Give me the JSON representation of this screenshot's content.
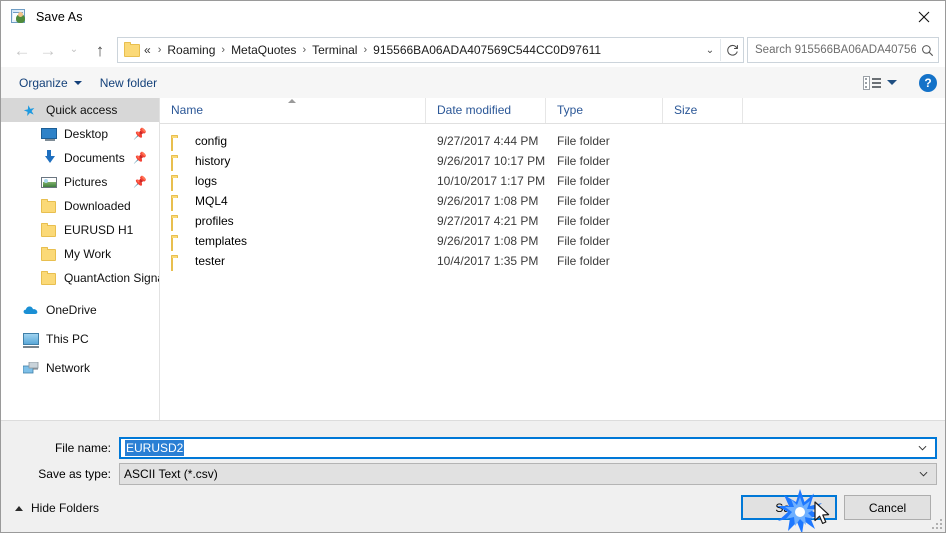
{
  "window": {
    "title": "Save As",
    "title_icon": "spreadsheet-person-icon",
    "close_label": "✕"
  },
  "navigation": {
    "back_icon": "back-arrow-icon",
    "forward_icon": "forward-arrow-icon",
    "recent_icon": "chevron-down-icon",
    "up_icon": "up-arrow-icon",
    "breadcrumb_lead": "«",
    "breadcrumbs": [
      "Roaming",
      "MetaQuotes",
      "Terminal",
      "915566BA06ADA407569C544CC0D97611"
    ],
    "breadcrumb_separator": "›",
    "address_dropdown_icon": "chevron-down-icon",
    "refresh_icon": "refresh-icon"
  },
  "search": {
    "placeholder": "Search 915566BA06ADA40756...",
    "icon": "search-icon"
  },
  "toolbar": {
    "organize_label": "Organize",
    "new_folder_label": "New folder",
    "view_icon": "view-layout-icon",
    "view_caret_icon": "chevron-down-icon",
    "help_label": "?",
    "help_icon": "help-icon"
  },
  "sidebar": {
    "items": [
      {
        "label": "Quick access",
        "icon": "star-icon",
        "level": "root",
        "selected": true,
        "pinned": false
      },
      {
        "label": "Desktop",
        "icon": "monitor-icon",
        "level": "child",
        "selected": false,
        "pinned": true
      },
      {
        "label": "Documents",
        "icon": "download-icon",
        "level": "child",
        "selected": false,
        "pinned": true
      },
      {
        "label": "Pictures",
        "icon": "pictures-icon",
        "level": "child",
        "selected": false,
        "pinned": true
      },
      {
        "label": "Downloaded",
        "icon": "folder-icon",
        "level": "child",
        "selected": false,
        "pinned": false
      },
      {
        "label": "EURUSD H1",
        "icon": "folder-icon",
        "level": "child",
        "selected": false,
        "pinned": false
      },
      {
        "label": "My Work",
        "icon": "folder-icon",
        "level": "child",
        "selected": false,
        "pinned": false
      },
      {
        "label": "QuantAction Signal",
        "icon": "folder-icon",
        "level": "child",
        "selected": false,
        "pinned": false
      },
      {
        "label": "OneDrive",
        "icon": "cloud-icon",
        "level": "root",
        "selected": false,
        "pinned": false
      },
      {
        "label": "This PC",
        "icon": "computer-icon",
        "level": "root",
        "selected": false,
        "pinned": false
      },
      {
        "label": "Network",
        "icon": "network-icon",
        "level": "root",
        "selected": false,
        "pinned": false
      }
    ],
    "pin_icon": "pin-icon"
  },
  "file_list": {
    "columns": [
      "Name",
      "Date modified",
      "Type",
      "Size"
    ],
    "sort_column": "Name",
    "sort_direction": "ascending",
    "rows": [
      {
        "name": "config",
        "date_modified": "9/27/2017 4:44 PM",
        "type": "File folder",
        "size": ""
      },
      {
        "name": "history",
        "date_modified": "9/26/2017 10:17 PM",
        "type": "File folder",
        "size": ""
      },
      {
        "name": "logs",
        "date_modified": "10/10/2017 1:17 PM",
        "type": "File folder",
        "size": ""
      },
      {
        "name": "MQL4",
        "date_modified": "9/26/2017 1:08 PM",
        "type": "File folder",
        "size": ""
      },
      {
        "name": "profiles",
        "date_modified": "9/27/2017 4:21 PM",
        "type": "File folder",
        "size": ""
      },
      {
        "name": "templates",
        "date_modified": "9/26/2017 1:08 PM",
        "type": "File folder",
        "size": ""
      },
      {
        "name": "tester",
        "date_modified": "10/4/2017 1:35 PM",
        "type": "File folder",
        "size": ""
      }
    ]
  },
  "form": {
    "file_name_label": "File name:",
    "file_name_value": "EURUSD2",
    "save_as_type_label": "Save as type:",
    "save_as_type_value": "ASCII Text (*.csv)",
    "dropdown_icon": "chevron-down-icon"
  },
  "footer": {
    "hide_folders_label": "Hide Folders",
    "hide_folders_icon": "chevron-up-icon",
    "save_label": "Save",
    "cancel_label": "Cancel",
    "resize_grip_icon": "resize-grip-icon",
    "click_indicator_icon": "click-burst-icon",
    "cursor_icon": "mouse-pointer-icon"
  },
  "colors": {
    "accent": "#0078d7",
    "link_text": "#14417a",
    "column_header_text": "#2b5797",
    "selection": "#2a7fd4",
    "folder_yellow": "#fbd977",
    "sidebar_selected": "#d7d7d7"
  }
}
